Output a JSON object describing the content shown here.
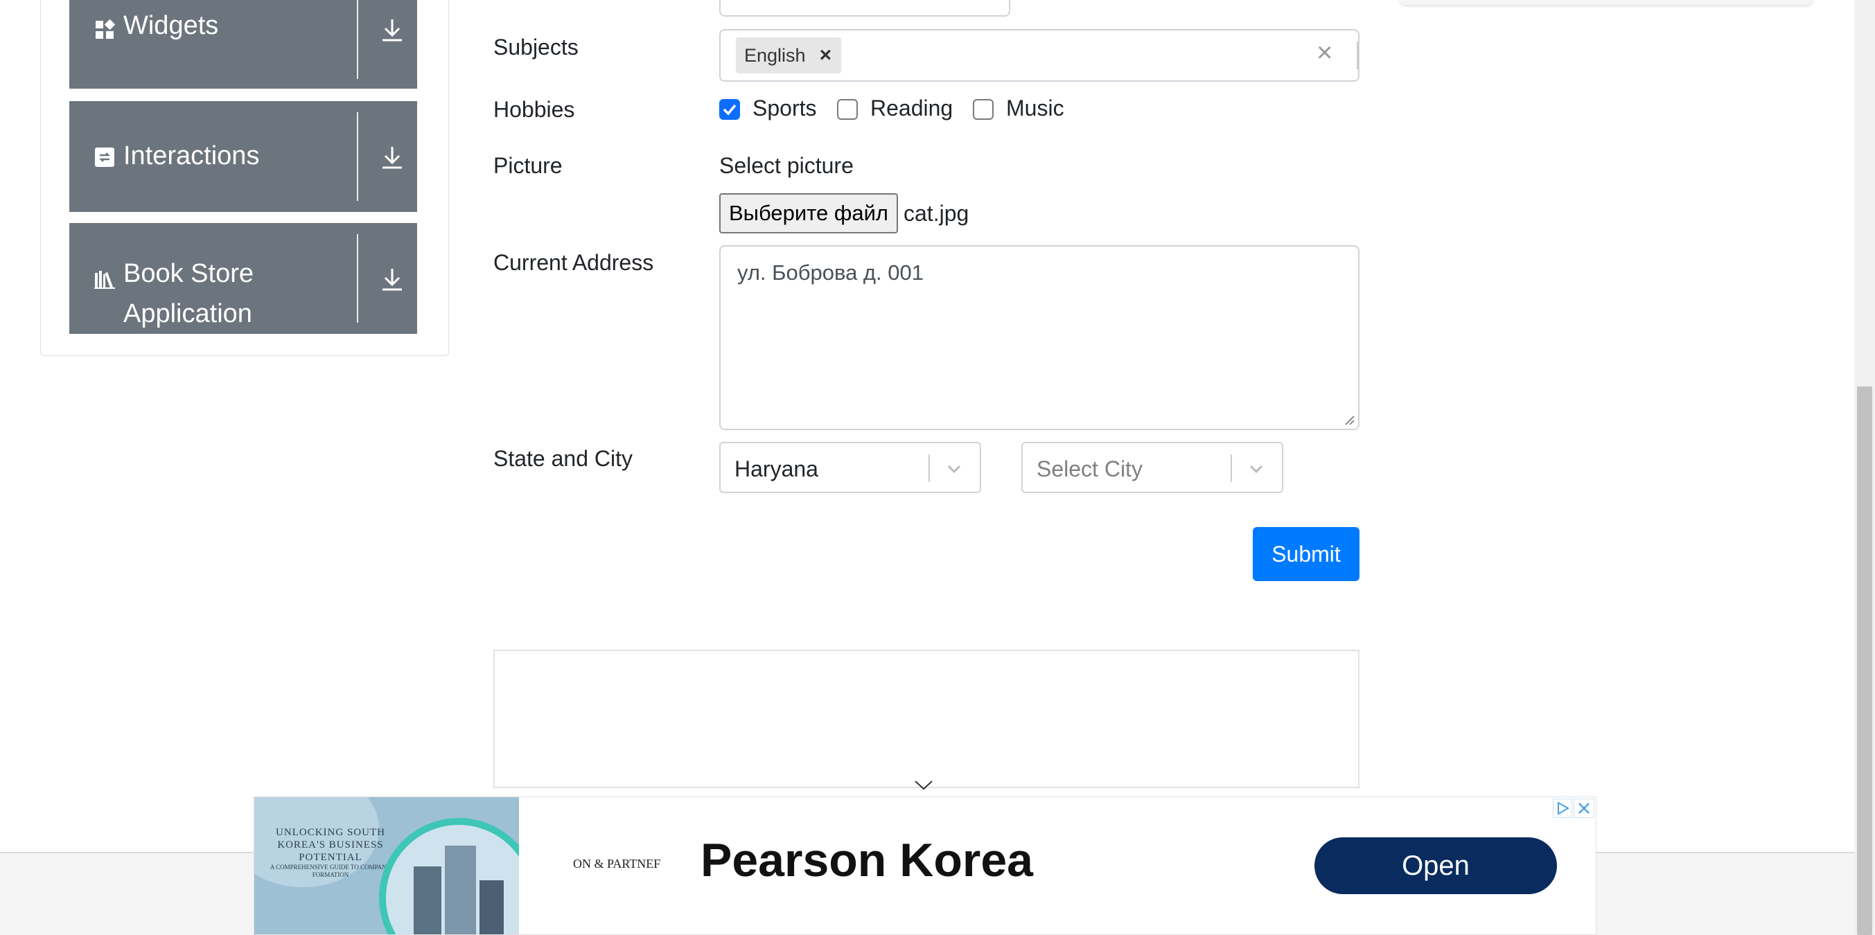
{
  "sidebar": {
    "groups": [
      {
        "label": "Widgets",
        "icon": "widgets-icon"
      },
      {
        "label": "Interactions",
        "icon": "interactions-icon"
      },
      {
        "label": "Book Store",
        "label_line2": "Application",
        "icon": "book-store-icon"
      }
    ]
  },
  "form": {
    "subjects": {
      "label": "Subjects",
      "chips": [
        "English"
      ]
    },
    "hobbies": {
      "label": "Hobbies",
      "options": [
        {
          "label": "Sports",
          "checked": true
        },
        {
          "label": "Reading",
          "checked": false
        },
        {
          "label": "Music",
          "checked": false
        }
      ]
    },
    "picture": {
      "label": "Picture",
      "select_label": "Select picture",
      "button": "Выберите файл",
      "file_name": "cat.jpg"
    },
    "address": {
      "label": "Current Address",
      "value": "ул. Боброва д. 001"
    },
    "state_city": {
      "label": "State and City",
      "state_value": "Haryana",
      "city_placeholder": "Select City"
    },
    "submit": "Submit"
  },
  "ad": {
    "image_headline": "UNLOCKING SOUTH KOREA'S BUSINESS POTENTIAL",
    "image_subtext": "A COMPREHENSIVE GUIDE TO COMPANY FORMATION",
    "brand_small": "ON & PARTNEF",
    "brand": "Pearson Korea",
    "cta": "Open"
  },
  "colors": {
    "sidebar_group_bg": "#6c757d",
    "primary": "#007bff",
    "checkbox_checked": "#0d6efd",
    "ad_button": "#0a2b5e"
  }
}
